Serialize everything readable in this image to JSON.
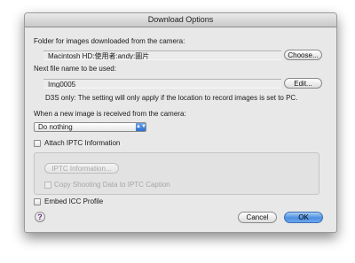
{
  "window": {
    "title": "Download Options"
  },
  "folder": {
    "label": "Folder for images downloaded from the camera:",
    "value": "Macintosh HD:使用者:andy:圖片",
    "choose_label": "Choose..."
  },
  "filename": {
    "label": "Next file name to be used:",
    "value": "Img0005",
    "edit_label": "Edit...",
    "note": "D3S only: The setting will only apply if the location to record images is set to PC."
  },
  "new_image": {
    "label": "When a new image is received from the camera:",
    "selected": "Do nothing"
  },
  "iptc": {
    "attach_label": "Attach IPTC Information",
    "attach_checked": false,
    "info_button_label": "IPTC Information...",
    "copy_label": "Copy Shooting Data to IPTC Caption",
    "copy_checked": false
  },
  "icc": {
    "embed_label": "Embed ICC Profile",
    "embed_checked": false
  },
  "footer": {
    "help_symbol": "?",
    "cancel_label": "Cancel",
    "ok_label": "OK"
  }
}
